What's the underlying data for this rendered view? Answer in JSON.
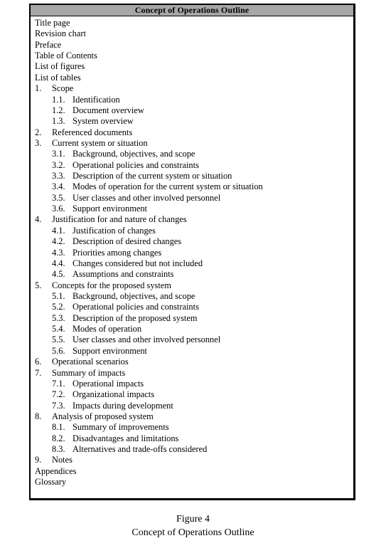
{
  "outline": {
    "header": "Concept of Operations Outline",
    "items": [
      {
        "level": 0,
        "num": "",
        "label": "Title page"
      },
      {
        "level": 0,
        "num": "",
        "label": "Revision chart"
      },
      {
        "level": 0,
        "num": "",
        "label": "Preface"
      },
      {
        "level": 0,
        "num": "",
        "label": "Table of Contents"
      },
      {
        "level": 0,
        "num": "",
        "label": "List of figures"
      },
      {
        "level": 0,
        "num": "",
        "label": "List of tables"
      },
      {
        "level": 1,
        "num": "1.",
        "label": "Scope"
      },
      {
        "level": 2,
        "num": "1.1.",
        "label": "Identification"
      },
      {
        "level": 2,
        "num": "1.2.",
        "label": "Document overview"
      },
      {
        "level": 2,
        "num": "1.3.",
        "label": "System overview"
      },
      {
        "level": 1,
        "num": "2.",
        "label": "Referenced documents"
      },
      {
        "level": 1,
        "num": "3.",
        "label": "Current system or situation"
      },
      {
        "level": 2,
        "num": "3.1.",
        "label": "Background, objectives, and scope"
      },
      {
        "level": 2,
        "num": "3.2.",
        "label": "Operational policies and constraints"
      },
      {
        "level": 2,
        "num": "3.3.",
        "label": "Description of the current system or situation"
      },
      {
        "level": 2,
        "num": "3.4.",
        "label": "Modes of operation for the current system or situation"
      },
      {
        "level": 2,
        "num": "3.5.",
        "label": "User classes and other involved personnel"
      },
      {
        "level": 2,
        "num": "3.6.",
        "label": "Support environment"
      },
      {
        "level": 1,
        "num": "4.",
        "label": "Justification for and nature of changes"
      },
      {
        "level": 2,
        "num": "4.1.",
        "label": "Justification of changes"
      },
      {
        "level": 2,
        "num": "4.2.",
        "label": "Description of desired changes"
      },
      {
        "level": 2,
        "num": "4.3.",
        "label": "Priorities among changes"
      },
      {
        "level": 2,
        "num": "4.4.",
        "label": "Changes considered but not included"
      },
      {
        "level": 2,
        "num": "4.5.",
        "label": "Assumptions and constraints"
      },
      {
        "level": 1,
        "num": "5.",
        "label": "Concepts for the proposed system"
      },
      {
        "level": 2,
        "num": "5.1.",
        "label": "Background, objectives, and scope"
      },
      {
        "level": 2,
        "num": "5.2.",
        "label": "Operational policies and constraints"
      },
      {
        "level": 2,
        "num": "5.3.",
        "label": "Description of the proposed system"
      },
      {
        "level": 2,
        "num": "5.4.",
        "label": "Modes of operation"
      },
      {
        "level": 2,
        "num": "5.5.",
        "label": "User classes and other involved personnel"
      },
      {
        "level": 2,
        "num": "5.6.",
        "label": "Support environment"
      },
      {
        "level": 1,
        "num": "6.",
        "label": "Operational scenarios"
      },
      {
        "level": 1,
        "num": "7.",
        "label": "Summary of impacts"
      },
      {
        "level": 2,
        "num": "7.1.",
        "label": "Operational impacts"
      },
      {
        "level": 2,
        "num": "7.2.",
        "label": "Organizational impacts"
      },
      {
        "level": 2,
        "num": "7.3.",
        "label": "Impacts during development"
      },
      {
        "level": 1,
        "num": "8.",
        "label": "Analysis of proposed system"
      },
      {
        "level": 2,
        "num": "8.1.",
        "label": "Summary of improvements"
      },
      {
        "level": 2,
        "num": "8.2.",
        "label": "Disadvantages and limitations"
      },
      {
        "level": 2,
        "num": "8.3.",
        "label": "Alternatives and trade-offs considered"
      },
      {
        "level": 1,
        "num": "9.",
        "label": "Notes"
      },
      {
        "level": 0,
        "num": "",
        "label": "Appendices"
      },
      {
        "level": 0,
        "num": "",
        "label": "Glossary"
      }
    ]
  },
  "caption": {
    "figure_label": "Figure 4",
    "title": "Concept of Operations Outline"
  },
  "colors": {
    "header_background": "#a6a6a6",
    "border": "#000000"
  }
}
